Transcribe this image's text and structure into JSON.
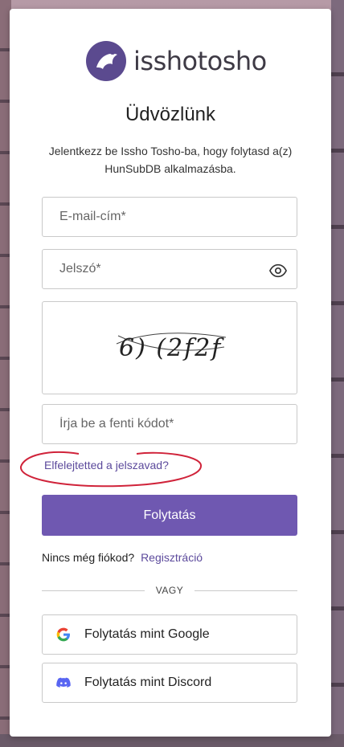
{
  "brand": {
    "name": "isshotosho",
    "primary_color": "#6f58b1"
  },
  "heading": "Üdvözlünk",
  "subtitle": "Jelentkezz be Issho Tosho-ba, hogy folytasd a(z) HunSubDB alkalmazásba.",
  "fields": {
    "email_placeholder": "E-mail-cím*",
    "password_placeholder": "Jelszó*",
    "captcha_input_placeholder": "Írja be a fenti kódot*"
  },
  "captcha_image_text": "6) (2f2f",
  "forgot_password": "Elfelejtetted a jelszavad?",
  "continue_button": "Folytatás",
  "signup": {
    "prompt": "Nincs még fiókod?",
    "link": "Regisztráció"
  },
  "divider": "VAGY",
  "social": {
    "google": "Folytatás mint Google",
    "discord": "Folytatás mint Discord"
  }
}
